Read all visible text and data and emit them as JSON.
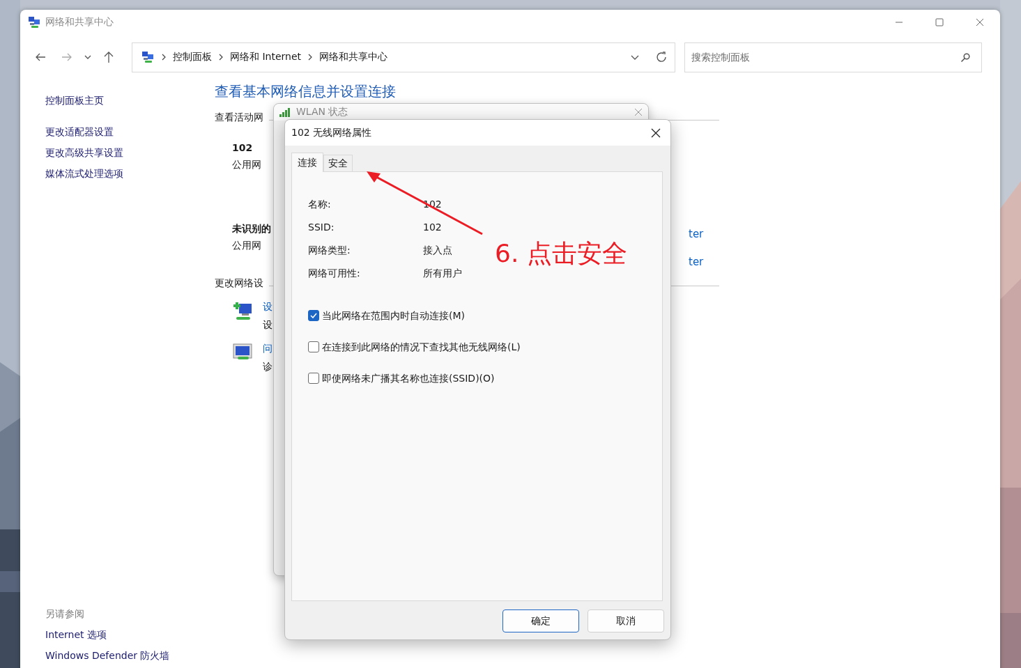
{
  "window": {
    "title": "网络和共享中心"
  },
  "nav": {
    "breadcrumbs": [
      "控制面板",
      "网络和 Internet",
      "网络和共享中心"
    ],
    "search": {
      "placeholder": "搜索控制面板"
    }
  },
  "sidebar": {
    "items": [
      {
        "label": "控制面板主页"
      },
      {
        "label": "更改适配器设置"
      },
      {
        "label": "更改高级共享设置"
      },
      {
        "label": "媒体流式处理选项"
      }
    ],
    "see_also": {
      "title": "另请参阅",
      "items": [
        {
          "label": "Internet 选项"
        },
        {
          "label": "Windows Defender 防火墙"
        }
      ]
    }
  },
  "main": {
    "heading": "查看基本网络信息并设置连接",
    "active_label": "查看活动网",
    "networks": [
      {
        "name": "102",
        "type": "公用网"
      },
      {
        "name": "未识别的",
        "type": "公用网",
        "links": [
          "ter",
          "ter"
        ]
      }
    ],
    "change_label": "更改网络设",
    "tasks": [
      {
        "title": "设",
        "desc": "设"
      },
      {
        "title": "问",
        "desc": "诊"
      }
    ]
  },
  "back_dialog": {
    "title": "WLAN 状态"
  },
  "dialog": {
    "title": "102 无线网络属性",
    "tabs": [
      {
        "label": "连接",
        "selected": true
      },
      {
        "label": "安全",
        "selected": false
      }
    ],
    "fields": [
      {
        "label": "名称:",
        "value": "102"
      },
      {
        "label": "SSID:",
        "value": "102"
      },
      {
        "label": "网络类型:",
        "value": "接入点"
      },
      {
        "label": "网络可用性:",
        "value": "所有用户"
      }
    ],
    "options": [
      {
        "label": "当此网络在范围内时自动连接(M)",
        "checked": true
      },
      {
        "label": "在连接到此网络的情况下查找其他无线网络(L)",
        "checked": false
      },
      {
        "label": "即使网络未广播其名称也连接(SSID)(O)",
        "checked": false
      }
    ],
    "buttons": [
      {
        "label": "确定",
        "default": true
      },
      {
        "label": "取消",
        "default": false
      }
    ]
  },
  "annotation": {
    "text": "6. 点击安全"
  }
}
